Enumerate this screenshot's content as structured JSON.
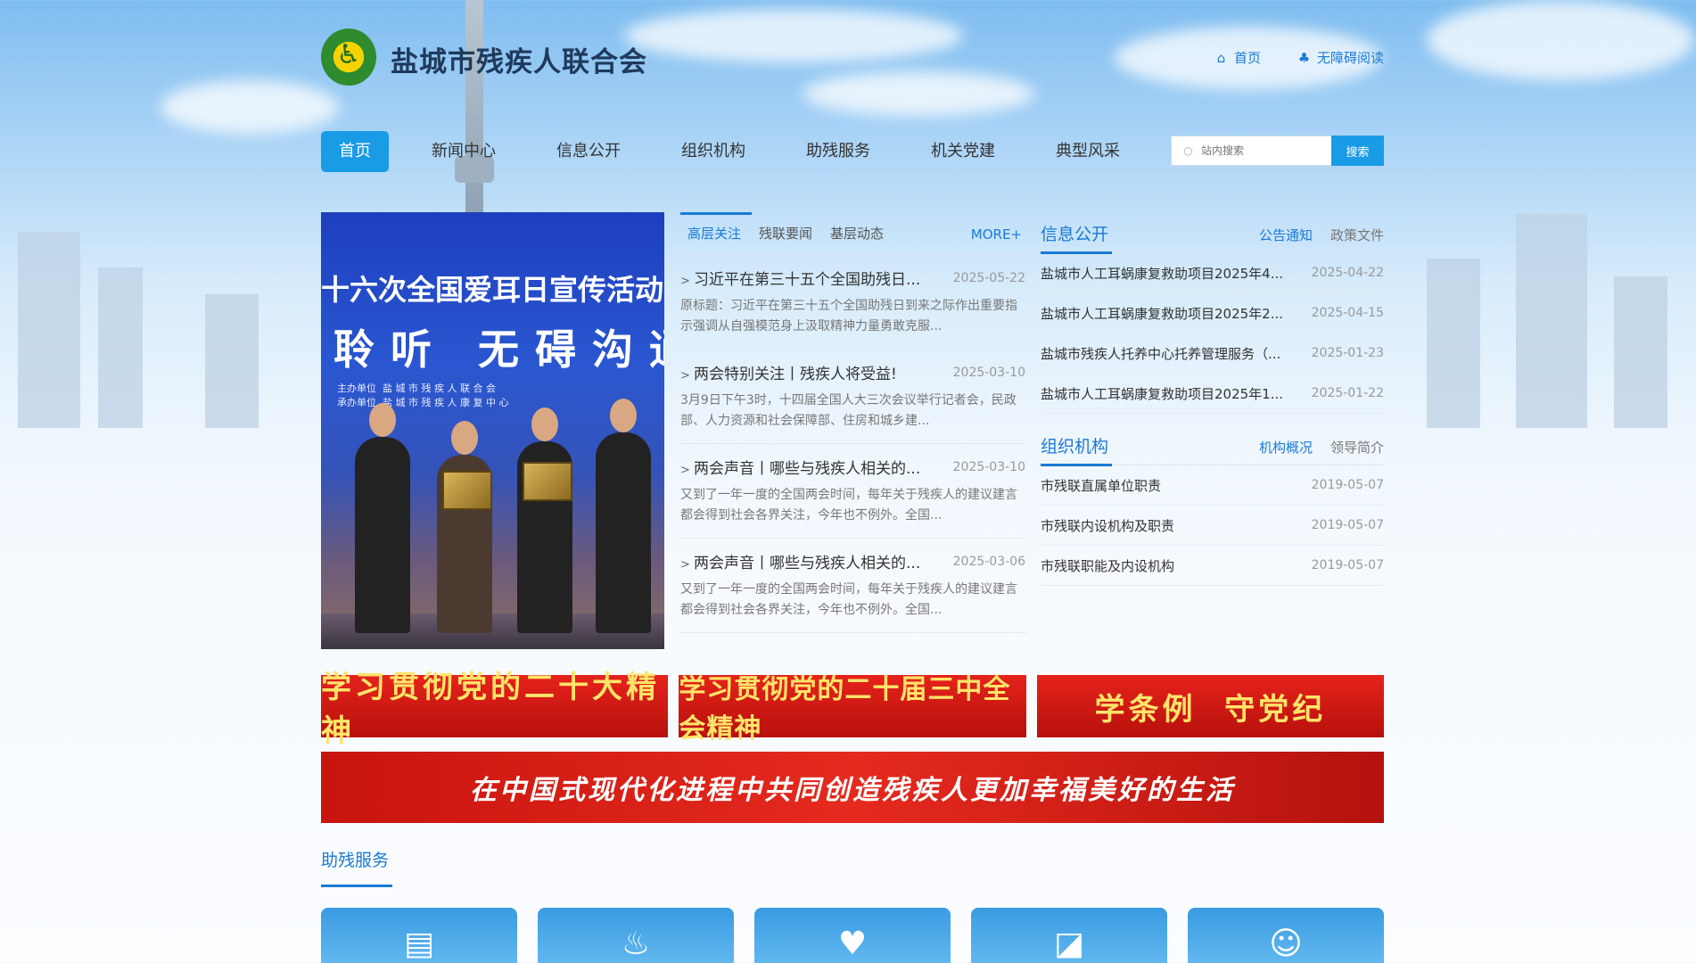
{
  "header": {
    "site_title": "盐城市残疾人联合会",
    "home_link": "首页",
    "accessibility_link": "无障碍阅读"
  },
  "nav": {
    "items": [
      "首页",
      "新闻中心",
      "信息公开",
      "组织机构",
      "助残服务",
      "机关党建",
      "典型风采"
    ],
    "active": "首页",
    "search_placeholder": "站内搜索",
    "search_button": "搜索"
  },
  "slide": {
    "line1": "十六次全国爱耳日宣传活动",
    "line2": "聆听 无碍沟通",
    "line3": "主办单位  盐 城 市 残 疾 人 联 合 会\n承办单位  盐 城 市 残 疾 人 康 复 中 心"
  },
  "news": {
    "tabs": [
      "高层关注",
      "残联要闻",
      "基层动态"
    ],
    "active_tab": "高层关注",
    "more": "MORE+",
    "items": [
      {
        "title": "习近平在第三十五个全国助残日...",
        "date": "2025-05-22",
        "summary": "原标题：习近平在第三十五个全国助残日到来之际作出重要指示强调从自强模范身上汲取精神力量勇敢克服..."
      },
      {
        "title": "两会特别关注丨残疾人将受益!",
        "date": "2025-03-10",
        "summary": "3月9日下午3时，十四届全国人大三次会议举行记者会，民政部、人力资源和社会保障部、住房和城乡建..."
      },
      {
        "title": "两会声音丨哪些与残疾人相关的...",
        "date": "2025-03-10",
        "summary": "又到了一年一度的全国两会时间，每年关于残疾人的建议建言都会得到社会各界关注，今年也不例外。全国..."
      },
      {
        "title": "两会声音丨哪些与残疾人相关的...",
        "date": "2025-03-06",
        "summary": "又到了一年一度的全国两会时间，每年关于残疾人的建议建言都会得到社会各界关注，今年也不例外。全国..."
      }
    ]
  },
  "info": {
    "title": "信息公开",
    "tabs": [
      "公告通知",
      "政策文件"
    ],
    "active_tab": "公告通知",
    "items": [
      {
        "title": "盐城市人工耳蜗康复救助项目2025年4...",
        "date": "2025-04-22"
      },
      {
        "title": "盐城市人工耳蜗康复救助项目2025年2...",
        "date": "2025-04-15"
      },
      {
        "title": "盐城市残疾人托养中心托养管理服务（...",
        "date": "2025-01-23"
      },
      {
        "title": "盐城市人工耳蜗康复救助项目2025年1...",
        "date": "2025-01-22"
      }
    ]
  },
  "org": {
    "title": "组织机构",
    "tabs": [
      "机构概况",
      "领导简介"
    ],
    "active_tab": "机构概况",
    "items": [
      {
        "title": "市残联直属单位职责",
        "date": "2019-05-07"
      },
      {
        "title": "市残联内设机构及职责",
        "date": "2019-05-07"
      },
      {
        "title": "市残联职能及内设机构",
        "date": "2019-05-07"
      }
    ]
  },
  "banners": {
    "items": [
      "学习贯彻党的二十大精神",
      "学习贯彻党的二十届三中全会精神",
      "学条例  守党纪"
    ],
    "wide": "在中国式现代化进程中共同创造残疾人更加幸福美好的生活"
  },
  "services": {
    "title": "助残服务",
    "icons": [
      "id-card-icon",
      "massage-icon",
      "heart-hand-icon",
      "presentation-icon",
      "person-icon"
    ]
  },
  "colors": {
    "primary": "#1a9be6",
    "link": "#1a7ad4",
    "banner_red": "#d8201a",
    "banner_text": "#ffe46a"
  }
}
